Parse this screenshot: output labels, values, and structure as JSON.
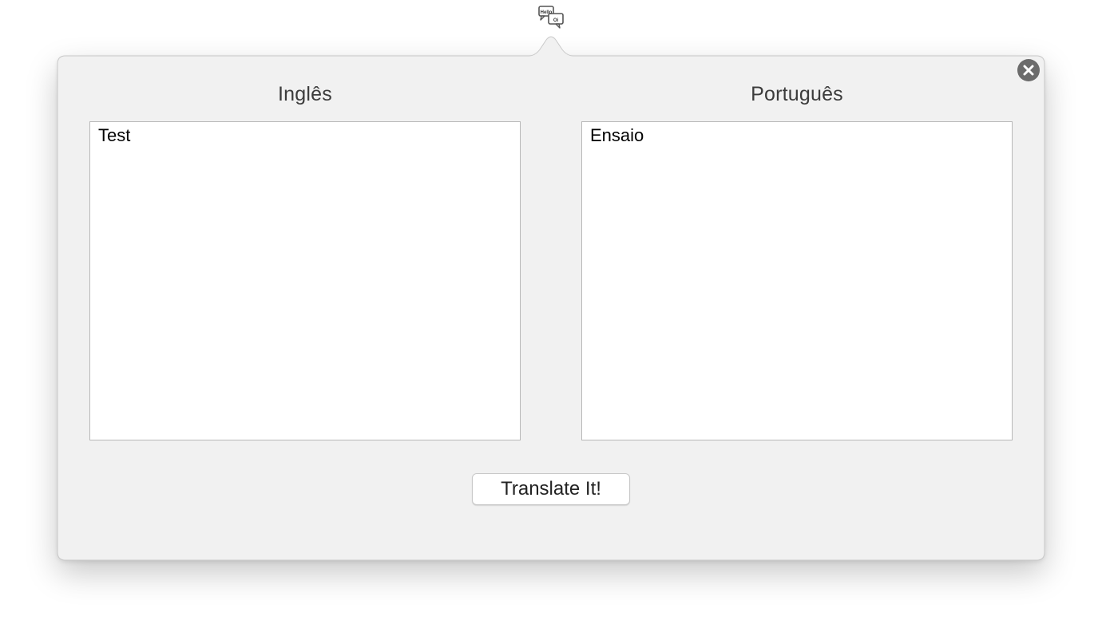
{
  "menubar": {
    "icon": "translate-speech-bubbles-icon",
    "icon_text_primary": "Hello",
    "icon_text_secondary": "Oi"
  },
  "popover": {
    "close_icon": "close-circle-icon",
    "source": {
      "language": "Inglês",
      "text": "Test"
    },
    "target": {
      "language": "Português",
      "text": "Ensaio"
    },
    "translate_label": "Translate It!"
  },
  "colors": {
    "popover_bg": "#f1f1f1",
    "popover_border": "#c9c9c9",
    "close_button": "#6b6b6b",
    "title_text": "#3c3c3c"
  }
}
